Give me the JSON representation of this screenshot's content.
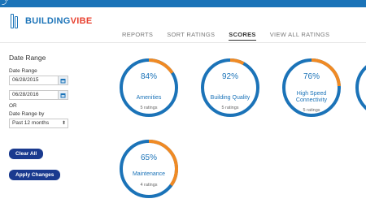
{
  "brand": {
    "part1": "BUILDING",
    "part2": "VIBE"
  },
  "topbar": {
    "glyph": "⤴"
  },
  "tabs": [
    "REPORTS",
    "SORT RATINGS",
    "SCORES",
    "VIEW ALL RATINGS"
  ],
  "active_tab": "SCORES",
  "filters": {
    "title": "Date Range",
    "date_range_label": "Date Range",
    "start_date": "06/28/2015",
    "end_date": "06/28/2016",
    "or_label": "OR",
    "range_by_label": "Date Range by",
    "range_by_value": "Past 12 months",
    "clear_label": "Clear All",
    "apply_label": "Apply Changes"
  },
  "colors": {
    "ring": "#1b73b8",
    "accent": "#f08a24",
    "button": "#1a3a8f"
  },
  "icons": {
    "calendar": "calendar-icon",
    "dropdown": "chevron-down-icon"
  },
  "scores": [
    {
      "pct": "84%",
      "name": "Amenities",
      "ratings": "5 ratings",
      "value": 0.84
    },
    {
      "pct": "92%",
      "name": "Building Quality",
      "ratings": "5 ratings",
      "value": 0.92
    },
    {
      "pct": "76%",
      "name": "High Speed Connectivity",
      "ratings": "5 ratings",
      "value": 0.76
    },
    {
      "pct": "65%",
      "name": "Maintenance",
      "ratings": "4 ratings",
      "value": 0.65
    }
  ]
}
